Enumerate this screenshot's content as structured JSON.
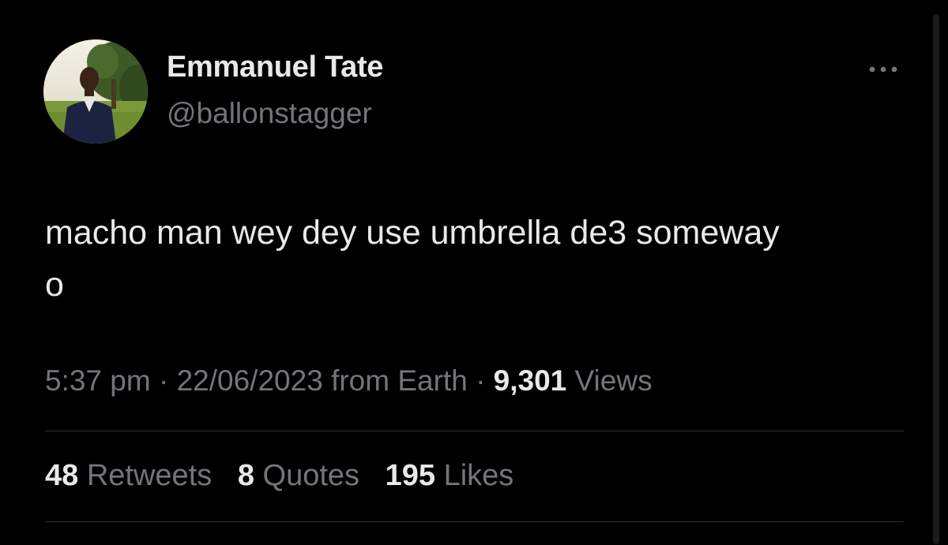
{
  "tweet": {
    "author": {
      "display_name": "Emmanuel Tate",
      "handle": "@ballonstagger",
      "avatar_icon": "profile-photo-avatar"
    },
    "more_icon": "more-horizontal-icon",
    "text_line1": "macho man wey dey use umbrella de3 someway",
    "text_line2": "o",
    "meta": {
      "time": "5:37 pm",
      "separator": "·",
      "date": "22/06/2023",
      "source": "from Earth",
      "views_count": "9,301",
      "views_label": "Views"
    },
    "stats": {
      "retweets_count": "48",
      "retweets_label": "Retweets",
      "quotes_count": "8",
      "quotes_label": "Quotes",
      "likes_count": "195",
      "likes_label": "Likes"
    }
  },
  "colors": {
    "background": "#000000",
    "primary_text": "#e7e9ea",
    "secondary_text": "#71767b",
    "divider": "#2f3336"
  }
}
